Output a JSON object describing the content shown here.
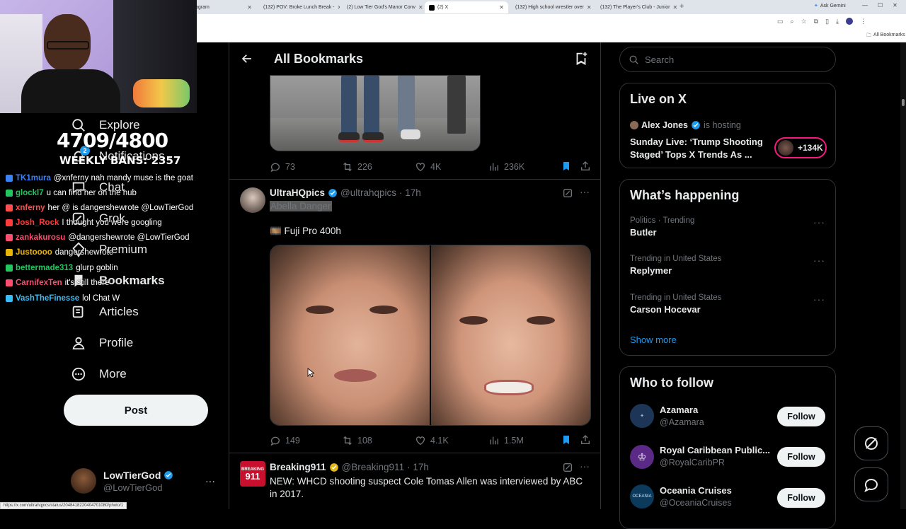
{
  "browser": {
    "tabs": [
      {
        "label": "agram",
        "active": false
      },
      {
        "label": "(132) POV: Broke Lunch Break -",
        "active": false
      },
      {
        "label": "(2) Low Tier God's Manor Conv",
        "active": false
      },
      {
        "label": "(2) X",
        "active": true
      },
      {
        "label": "(132) High school wrestler over",
        "active": false
      },
      {
        "label": "(132) The Player's Club - Junior",
        "active": false
      }
    ],
    "ask_gemini": "Ask Gemini",
    "all_bookmarks": "All Bookmarks",
    "status_url": "https://x.com/ultrahqpics/status/2048418220404701080/photo/1"
  },
  "stream": {
    "counter": "4709/4800",
    "weekly": "WEEKLY BANS: 2357",
    "chat": [
      {
        "user": "TK1mura",
        "color": "#3b82f6",
        "msg": "@xnferny nah mandy muse is the goat"
      },
      {
        "user": "glockl7",
        "color": "#22c55e",
        "msg": "u can find her on the hub"
      },
      {
        "user": "xnferny",
        "color": "#ff4d4d",
        "msg": "her @ is dangershewrote @LowTierGod"
      },
      {
        "user": "Josh_Rock",
        "color": "#ff3b3b",
        "msg": "I thought you were googling"
      },
      {
        "user": "zankakurosu",
        "color": "#ff4d6d",
        "msg": "@dangershewrote @LowTierGod"
      },
      {
        "user": "Justoooo",
        "color": "#eab308",
        "msg": "dangershewrote"
      },
      {
        "user": "bettermade313",
        "color": "#22c55e",
        "msg": "glurp goblin"
      },
      {
        "user": "CarnifexTen",
        "color": "#ff4d6d",
        "msg": "it's still there"
      },
      {
        "user": "VashTheFinesse",
        "color": "#38bdf8",
        "msg": "lol Chat W"
      }
    ]
  },
  "nav": {
    "items": [
      {
        "label": "Explore",
        "icon": "search-icon"
      },
      {
        "label": "Notifications",
        "icon": "bell-icon"
      },
      {
        "label": "Chat",
        "icon": "chat-icon"
      },
      {
        "label": "Grok",
        "icon": "grok-icon"
      },
      {
        "label": "Premium",
        "icon": "premium-icon"
      },
      {
        "label": "Bookmarks",
        "icon": "bookmark-icon"
      },
      {
        "label": "Articles",
        "icon": "articles-icon"
      },
      {
        "label": "Profile",
        "icon": "person-icon"
      },
      {
        "label": "More",
        "icon": "more-circle-icon"
      }
    ],
    "notification_count": "2",
    "post_label": "Post",
    "account_name": "LowTierGod",
    "account_handle": "@LowTierGod"
  },
  "header": {
    "title": "All Bookmarks"
  },
  "tweets": [
    {
      "replies": "73",
      "reposts": "226",
      "likes": "4K",
      "views": "236K"
    },
    {
      "name": "UltraHQpics",
      "handle": "@ultrahqpics",
      "time": "· 17h",
      "highlight": "Abella Danger",
      "text": "🎞️ Fuji Pro 400h",
      "replies": "149",
      "reposts": "108",
      "likes": "4.1K",
      "views": "1.5M"
    },
    {
      "name": "Breaking911",
      "handle": "@Breaking911",
      "time": "· 17h",
      "text": "NEW: WHCD shooting suspect Cole Tomas Allen was interviewed by ABC in 2017."
    }
  ],
  "search": {
    "placeholder": "Search"
  },
  "live": {
    "title": "Live on X",
    "host": "Alex Jones",
    "hosting": "is hosting",
    "topic": "Sunday Live: ‘Trump Shooting Staged’ Tops X Trends As ...",
    "listeners": "+134K"
  },
  "happening": {
    "title": "What’s happening",
    "trends": [
      {
        "context": "Politics · Trending",
        "name": "Butler"
      },
      {
        "context": "Trending in United States",
        "name": "Replymer"
      },
      {
        "context": "Trending in United States",
        "name": "Carson Hocevar"
      }
    ],
    "show_more": "Show more"
  },
  "who_to_follow": {
    "title": "Who to follow",
    "follow_label": "Follow",
    "accounts": [
      {
        "name": "Azamara",
        "handle": "@Azamara",
        "color": "#1d3557"
      },
      {
        "name": "Royal Caribbean Public...",
        "handle": "@RoyalCaribPR",
        "color": "#5b2a86"
      },
      {
        "name": "Oceania Cruises",
        "handle": "@OceaniaCruises",
        "color": "#0b3a5c"
      }
    ]
  },
  "colors": {
    "accent": "#1d9bf0",
    "bookmark_active": "#1d9bf0"
  }
}
